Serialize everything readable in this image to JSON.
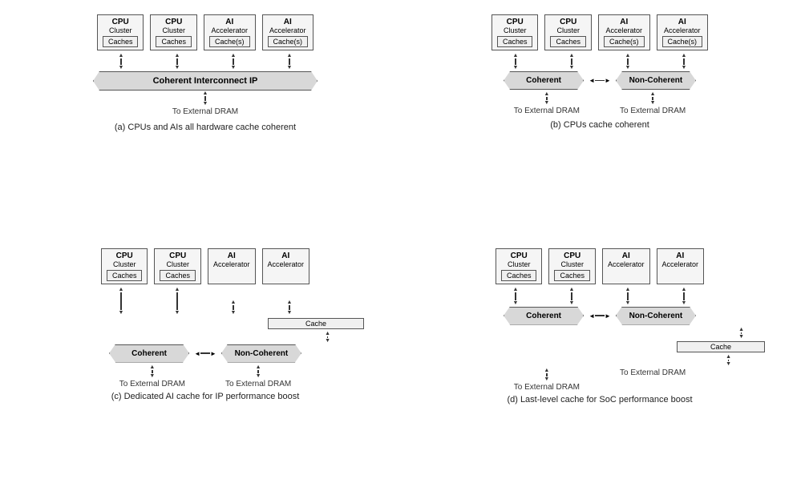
{
  "diagrams": [
    {
      "id": "a",
      "caption": "(a) CPUs and AIs all hardware cache coherent",
      "units": [
        {
          "title": "CPU",
          "sub": "Cluster",
          "cache": "Caches"
        },
        {
          "title": "CPU",
          "sub": "Cluster",
          "cache": "Caches"
        },
        {
          "title": "AI",
          "sub": "Accelerator",
          "cache": "Cache(s)"
        },
        {
          "title": "AI",
          "sub": "Accelerator",
          "cache": "Cache(s)"
        }
      ],
      "interconnect": "Coherent Interconnect IP",
      "dram_labels": [
        "To External DRAM"
      ],
      "type": "single_banner"
    },
    {
      "id": "b",
      "caption": "(b) CPUs cache coherent",
      "units": [
        {
          "title": "CPU",
          "sub": "Cluster",
          "cache": "Caches"
        },
        {
          "title": "CPU",
          "sub": "Cluster",
          "cache": "Caches"
        },
        {
          "title": "AI",
          "sub": "Accelerator",
          "cache": "Cache(s)"
        },
        {
          "title": "AI",
          "sub": "Accelerator",
          "cache": "Cache(s)"
        }
      ],
      "banner_left": "Coherent",
      "banner_right": "Non-Coherent",
      "dram_labels": [
        "To External DRAM",
        "To External DRAM"
      ],
      "type": "dual_banner"
    },
    {
      "id": "c",
      "caption": "(c) Dedicated AI cache for IP performance boost",
      "units": [
        {
          "title": "CPU",
          "sub": "Cluster",
          "cache": "Caches"
        },
        {
          "title": "CPU",
          "sub": "Cluster",
          "cache": "Caches"
        },
        {
          "title": "AI",
          "sub": "Accelerator",
          "cache": null
        },
        {
          "title": "AI",
          "sub": "Accelerator",
          "cache": null
        }
      ],
      "ai_cache": "Cache",
      "banner_left": "Coherent",
      "banner_right": "Non-Coherent",
      "dram_labels": [
        "To External DRAM",
        "To External DRAM"
      ],
      "type": "dual_banner_cache"
    },
    {
      "id": "d",
      "caption": "(d) Last-level cache for SoC performance boost",
      "units": [
        {
          "title": "CPU",
          "sub": "Cluster",
          "cache": "Caches"
        },
        {
          "title": "CPU",
          "sub": "Cluster",
          "cache": "Caches"
        },
        {
          "title": "AI",
          "sub": "Accelerator",
          "cache": null
        },
        {
          "title": "AI",
          "sub": "Accelerator",
          "cache": null
        }
      ],
      "llc": "Cache",
      "banner_left": "Coherent",
      "banner_right": "Non-Coherent",
      "dram_labels": [
        "To External DRAM",
        "To External DRAM"
      ],
      "type": "dual_banner_llc"
    }
  ]
}
